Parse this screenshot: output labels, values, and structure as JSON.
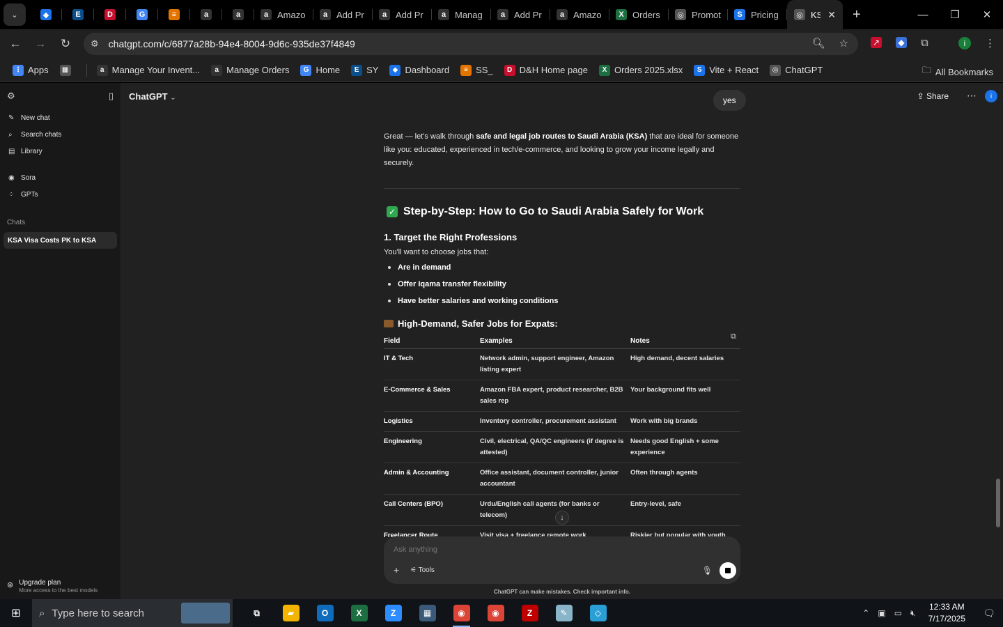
{
  "browser": {
    "tabs": [
      {
        "icon": "kite-icon",
        "title": "",
        "color": "#1a73e8"
      },
      {
        "icon": "ec-icon",
        "title": "",
        "color": "#0a4f8a"
      },
      {
        "icon": "dh-icon",
        "title": "",
        "color": "#c8102e"
      },
      {
        "icon": "g-icon",
        "title": "",
        "color": "#4285f4"
      },
      {
        "icon": "stack-icon",
        "title": "",
        "color": "#e37400"
      },
      {
        "icon": "amazon-icon",
        "title": "",
        "color": "#333"
      },
      {
        "icon": "amazon-icon",
        "title": "",
        "color": "#333"
      },
      {
        "icon": "amazon-icon",
        "title": "Amazo",
        "color": "#333"
      },
      {
        "icon": "amazon-icon",
        "title": "Add Pr",
        "color": "#333"
      },
      {
        "icon": "amazon-icon",
        "title": "Add Pr",
        "color": "#333"
      },
      {
        "icon": "amazon-icon",
        "title": "Manag",
        "color": "#333"
      },
      {
        "icon": "amazon-icon",
        "title": "Add Pr",
        "color": "#333"
      },
      {
        "icon": "amazon-icon",
        "title": "Amazo",
        "color": "#333"
      },
      {
        "icon": "excel-icon",
        "title": "Orders",
        "color": "#1d6f42"
      },
      {
        "icon": "openai-icon",
        "title": "Promot",
        "color": "#555"
      },
      {
        "icon": "s-icon",
        "title": "Pricing",
        "color": "#1a73e8"
      }
    ],
    "active_tab": {
      "title": "KS",
      "icon": "openai-icon"
    },
    "url": "chatgpt.com/c/6877a28b-94e4-8004-9d6c-935de37f4849",
    "bookmarks": [
      {
        "label": "Apps",
        "icon": "apps-icon",
        "color": "#4285f4"
      },
      {
        "label": "",
        "icon": "tab-groups-icon",
        "color": "#555"
      },
      {
        "label": "Manage Your Invent...",
        "icon": "amazon-icon",
        "color": "#333"
      },
      {
        "label": "Manage Orders",
        "icon": "amazon-icon",
        "color": "#333"
      },
      {
        "label": "Home",
        "icon": "g-icon",
        "color": "#4285f4"
      },
      {
        "label": "SY",
        "icon": "ec-icon",
        "color": "#0a4f8a"
      },
      {
        "label": "Dashboard",
        "icon": "kite-icon",
        "color": "#1a73e8"
      },
      {
        "label": "SS_",
        "icon": "stack-icon",
        "color": "#e37400"
      },
      {
        "label": "D&H Home page",
        "icon": "dh-icon",
        "color": "#c8102e"
      },
      {
        "label": "Orders 2025.xlsx",
        "icon": "excel-icon",
        "color": "#1d6f42"
      },
      {
        "label": "Vite + React",
        "icon": "s-icon",
        "color": "#1a73e8"
      },
      {
        "label": "ChatGPT",
        "icon": "openai-icon",
        "color": "#555"
      }
    ],
    "all_bookmarks": "All Bookmarks"
  },
  "sidebar": {
    "items": [
      {
        "label": "New chat",
        "icon": "new-chat-icon"
      },
      {
        "label": "Search chats",
        "icon": "search-icon"
      },
      {
        "label": "Library",
        "icon": "library-icon"
      }
    ],
    "items2": [
      {
        "label": "Sora",
        "icon": "sora-icon"
      },
      {
        "label": "GPTs",
        "icon": "gpts-icon"
      }
    ],
    "chats_label": "Chats",
    "active_chat": "KSA Visa Costs PK to KSA",
    "upgrade_title": "Upgrade plan",
    "upgrade_sub": "More access to the best models"
  },
  "main": {
    "model": "ChatGPT",
    "share": "Share",
    "user_message": "yes",
    "intro_prefix": "Great — let's walk through ",
    "intro_bold": "safe and legal job routes to Saudi Arabia (KSA)",
    "intro_suffix": " that are ideal for someone like you: educated, experienced in tech/e-commerce, and looking to grow your income legally and securely.",
    "heading": "Step-by-Step: How to Go to Saudi Arabia Safely for Work",
    "section1": "1. Target the Right Professions",
    "section1_p": "You'll want to choose jobs that:",
    "bullets": [
      "Are in demand",
      "Offer Iqama transfer flexibility",
      "Have better salaries and working conditions"
    ],
    "table_title": "High-Demand, Safer Jobs for Expats:",
    "table_headers": [
      "Field",
      "Examples",
      "Notes"
    ],
    "table_rows": [
      [
        "IT & Tech",
        "Network admin, support engineer, Amazon listing expert",
        "High demand, decent salaries"
      ],
      [
        "E-Commerce & Sales",
        "Amazon FBA expert, product researcher, B2B sales rep",
        "Your background fits well"
      ],
      [
        "Logistics",
        "Inventory controller, procurement assistant",
        "Work with big brands"
      ],
      [
        "Engineering",
        "Civil, electrical, QA/QC engineers (if degree is attested)",
        "Needs good English + some experience"
      ],
      [
        "Admin & Accounting",
        "Office assistant, document controller, junior accountant",
        "Often through agents"
      ],
      [
        "Call Centers (BPO)",
        "Urdu/English call agents (for banks or telecom)",
        "Entry-level, safe"
      ],
      [
        "Freelancer Route",
        "Visit visa + freelance remote work",
        "Riskier but popular with youth"
      ]
    ],
    "composer_placeholder": "Ask anything",
    "tools": "Tools",
    "disclaimer": "ChatGPT can make mistakes. Check important info."
  },
  "taskbar": {
    "search_placeholder": "Type here to search",
    "apps": [
      {
        "icon": "task-view-icon",
        "color": "transparent",
        "running": false
      },
      {
        "icon": "file-explorer-icon",
        "color": "#f2b400",
        "running": false
      },
      {
        "icon": "outlook-icon",
        "color": "#0f6cbd",
        "running": false
      },
      {
        "icon": "excel-icon",
        "color": "#1d6f42",
        "running": false
      },
      {
        "icon": "zoom-icon",
        "color": "#2d8cff",
        "running": false
      },
      {
        "icon": "calculator-icon",
        "color": "#3b5a7a",
        "running": false
      },
      {
        "icon": "chrome-icon",
        "color": "#db4437",
        "running": true
      },
      {
        "icon": "chrome-profile-icon",
        "color": "#db4437",
        "running": false
      },
      {
        "icon": "filezilla-icon",
        "color": "#bf0000",
        "running": false
      },
      {
        "icon": "notes-icon",
        "color": "#8ab4c8",
        "running": false
      },
      {
        "icon": "vscode-icon",
        "color": "#2a9fd6",
        "running": false
      }
    ],
    "time": "12:33 AM",
    "date": "7/17/2025"
  }
}
